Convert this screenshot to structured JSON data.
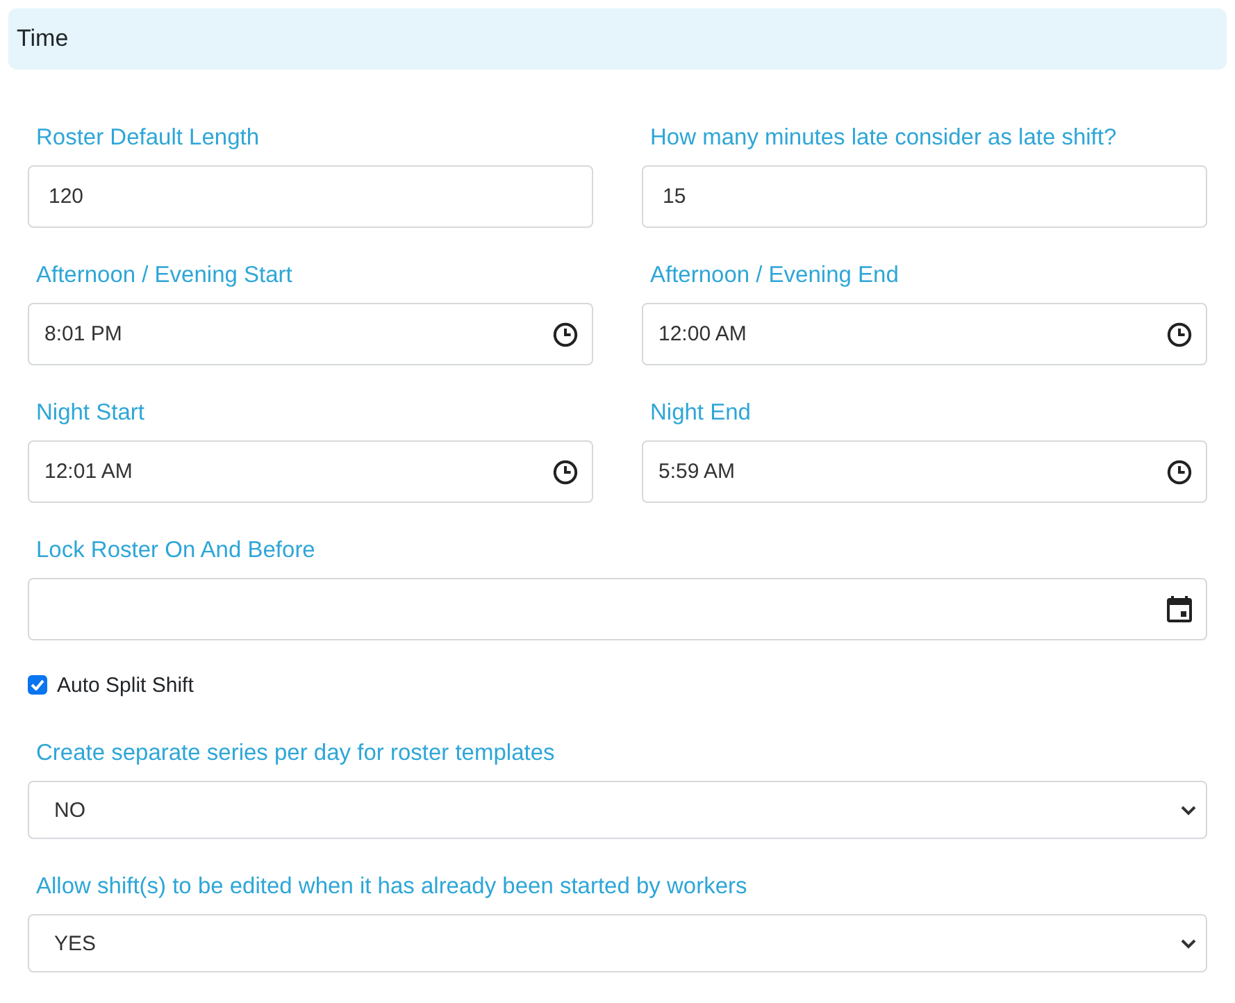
{
  "section": {
    "title": "Time"
  },
  "rows": [
    {
      "fields": [
        {
          "kind": "text",
          "label": "Roster Default Length",
          "value": "120"
        },
        {
          "kind": "text",
          "label": "How many minutes late consider as late shift?",
          "value": "15"
        }
      ]
    },
    {
      "fields": [
        {
          "kind": "time",
          "label": "Afternoon / Evening Start",
          "value": "8:01 PM"
        },
        {
          "kind": "time",
          "label": "Afternoon / Evening End",
          "value": "12:00 AM"
        }
      ]
    },
    {
      "fields": [
        {
          "kind": "time",
          "label": "Night Start",
          "value": "12:01 AM"
        },
        {
          "kind": "time",
          "label": "Night End",
          "value": "5:59 AM"
        }
      ]
    },
    {
      "fields": [
        {
          "kind": "date",
          "label": "Lock Roster On And Before"
        }
      ]
    },
    {
      "fields": [
        {
          "kind": "checkbox",
          "label": "Auto Split Shift",
          "checked": true
        }
      ]
    },
    {
      "fields": [
        {
          "kind": "select",
          "label": "Create separate series per day for roster templates",
          "value": "NO"
        }
      ]
    },
    {
      "fields": [
        {
          "kind": "select",
          "label": "Allow shift(s) to be edited when it has already been started by workers",
          "value": "YES"
        }
      ]
    }
  ]
}
